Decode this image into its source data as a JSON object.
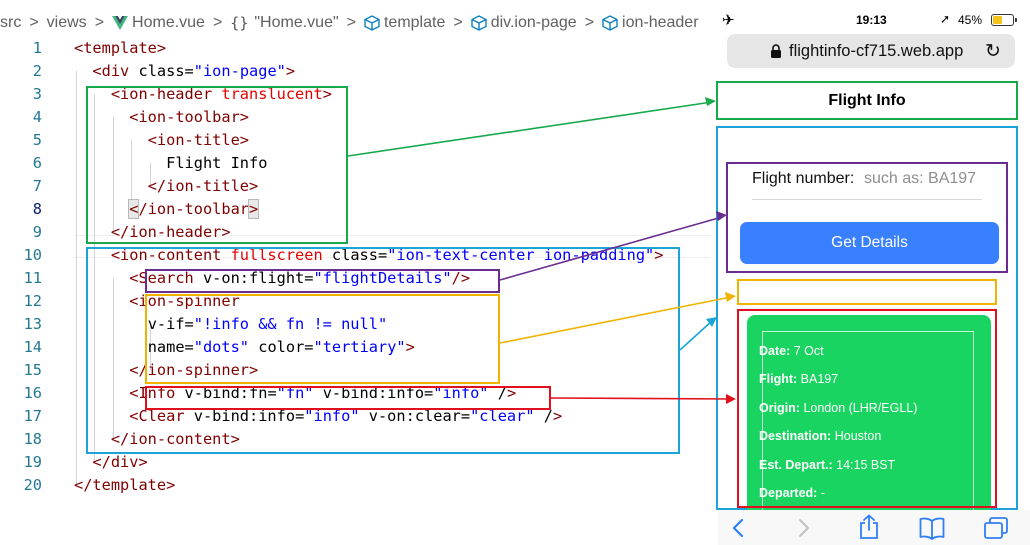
{
  "breadcrumb": {
    "items": [
      {
        "label": "src",
        "icon": ""
      },
      {
        "label": "views",
        "icon": ""
      },
      {
        "label": "Home.vue",
        "icon": "vue-icon"
      },
      {
        "label": "\"Home.vue\"",
        "icon": "braces-icon"
      },
      {
        "label": "template",
        "icon": "cube-icon"
      },
      {
        "label": "div.ion-page",
        "icon": "cube-icon"
      },
      {
        "label": "ion-header",
        "icon": "cube-icon"
      }
    ],
    "separator": ">",
    "braces_glyph": "{}"
  },
  "code": {
    "active_line": 8,
    "lines": [
      {
        "n": "1",
        "t": "<template>"
      },
      {
        "n": "2",
        "t": "  <div class=\"ion-page\">"
      },
      {
        "n": "3",
        "t": "    <ion-header translucent>"
      },
      {
        "n": "4",
        "t": "      <ion-toolbar>"
      },
      {
        "n": "5",
        "t": "        <ion-title>"
      },
      {
        "n": "6",
        "t": "          Flight Info"
      },
      {
        "n": "7",
        "t": "        </ion-title>"
      },
      {
        "n": "8",
        "t": "      </ion-toolbar>"
      },
      {
        "n": "9",
        "t": "    </ion-header>"
      },
      {
        "n": "10",
        "t": "    <ion-content fullscreen class=\"ion-text-center ion-padding\">"
      },
      {
        "n": "11",
        "t": "      <Search v-on:flight=\"flightDetails\"/>"
      },
      {
        "n": "12",
        "t": "      <ion-spinner"
      },
      {
        "n": "13",
        "t": "        v-if=\"!info && fn != null\""
      },
      {
        "n": "14",
        "t": "        name=\"dots\" color=\"tertiary\">"
      },
      {
        "n": "15",
        "t": "      </ion-spinner>"
      },
      {
        "n": "16",
        "t": "      <Info v-bind:fn=\"fn\" v-bind:info=\"info\" />"
      },
      {
        "n": "17",
        "t": "      <Clear v-bind:info=\"info\" v-on:clear=\"clear\" />"
      },
      {
        "n": "18",
        "t": "    </ion-content>"
      },
      {
        "n": "19",
        "t": "  </div>"
      },
      {
        "n": "20",
        "t": "</template>"
      }
    ]
  },
  "phone": {
    "status_bar": {
      "airplane_icon": "airplane-icon",
      "time": "19:13",
      "location_icon": "location-arrow-icon",
      "battery_text": "45%",
      "battery_level": 0.45
    },
    "url_bar": {
      "url": "flightinfo-cf715.web.app",
      "lock_icon": "lock-icon",
      "reload_icon": "reload-icon"
    },
    "header_title": "Flight Info",
    "search": {
      "label": "Flight number:",
      "placeholder": "such as: BA197",
      "button": "Get Details"
    },
    "info": {
      "rows": [
        {
          "label": "Date:",
          "value": "7 Oct"
        },
        {
          "label": "Flight:",
          "value": "BA197"
        },
        {
          "label": "Origin:",
          "value": "London (LHR/EGLL)"
        },
        {
          "label": "Destination:",
          "value": "Houston"
        },
        {
          "label": "Est. Depart.:",
          "value": "14:15 BST"
        },
        {
          "label": "Departed:",
          "value": "-"
        }
      ]
    },
    "bottom_bar": {
      "icons": [
        "back-icon",
        "forward-icon",
        "share-icon",
        "bookmarks-icon",
        "tabs-icon"
      ]
    }
  },
  "colors": {
    "header": "#18a94c",
    "content": "#1ba4d8",
    "search": "#6a2c91",
    "spinner": "#f0b400",
    "info": "#e0101e",
    "button": "#3880ff",
    "card": "#19d461"
  }
}
